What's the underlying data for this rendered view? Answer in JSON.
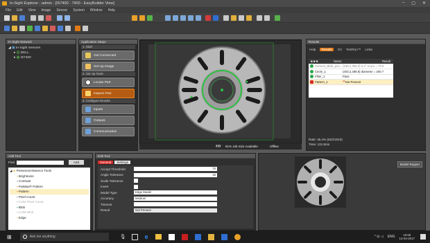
{
  "window": {
    "title": "In-Sight Explorer - admin - [IS7400 - 7400 - EasyBuilder View]",
    "controls": [
      "–",
      "▢",
      "✕"
    ]
  },
  "menu": [
    "File",
    "Edit",
    "View",
    "Image",
    "Sensor",
    "System",
    "Window",
    "Help"
  ],
  "network": {
    "header": "In-Sight Network",
    "items": [
      "In-Sight Sensors",
      "DELL",
      "IS7400"
    ]
  },
  "steps": {
    "header": "Application Steps",
    "sections": [
      {
        "title": "1. Start",
        "buttons": [
          "Get Connected",
          "Set Up Image"
        ]
      },
      {
        "title": "2. Set Up Tools",
        "buttons": [
          "Locate Part",
          "Inspect Part"
        ]
      },
      {
        "title": "3. Configure Results",
        "buttons": [
          "Inputs",
          "Outputs",
          "Communication"
        ]
      }
    ]
  },
  "viewer": {
    "status_memory": "81% Job Size Available",
    "status_mode": "Offline"
  },
  "results": {
    "header": "Results",
    "tabs": [
      "Help",
      "Results",
      "I/O",
      "TestRun™",
      "Links"
    ],
    "active_tab": "Results",
    "columns": [
      "Name",
      "Result"
    ],
    "rows": [
      {
        "name": "Camera_Blob_pos...",
        "result": "(158.1,305.0) 0.4° score = 70.6",
        "status": "ok"
      },
      {
        "name": "Circle_1",
        "result": "(403.2,288.8) diameter = 200.7",
        "status": "ok"
      },
      {
        "name": "Filter_1",
        "result": "Pass",
        "status": "ok"
      },
      {
        "name": "Pattern_1",
        "result": "Not Present",
        "status": "fail"
      }
    ],
    "rate": "Rate: 45.4% (622/1810)",
    "time": "Time: 131.8ms"
  },
  "add_tool": {
    "header": "Add Tool",
    "search_placeholder": "Find",
    "add_label": "Add",
    "group": "Presence/Absence Tools",
    "items": [
      "Brightness",
      "Contrast",
      "PatMax® Pattern",
      "Pattern",
      "Pixel Count",
      "Color Pixel Count",
      "Blob",
      "Color Blob",
      "Edge"
    ]
  },
  "edit_tool": {
    "header": "Edit Tool",
    "tabs": [
      "General",
      "Settings"
    ],
    "active_tab": "Settings",
    "props": [
      {
        "label": "Accept Threshold",
        "value": "70"
      },
      {
        "label": "Angle Tolerance",
        "value": "15"
      },
      {
        "label": "Scale Tolerance",
        "value": ""
      },
      {
        "label": "Invert",
        "value": ""
      },
      {
        "label": "Model Type",
        "value": "Edge Model"
      },
      {
        "label": "Accuracy",
        "value": "Medium"
      },
      {
        "label": "Timeout",
        "value": "1000"
      },
      {
        "label": "Result",
        "value": "Not Present"
      }
    ],
    "model_region_label": "Model Region"
  },
  "taskbar": {
    "search_placeholder": "Ask me anything",
    "lang": "ENG",
    "time": "15:06",
    "date": "13-04-2017"
  },
  "colors": {
    "accent": "#e07a15",
    "ok": "#2aa84a",
    "fail": "#d62828",
    "select": "#fcefc2"
  }
}
